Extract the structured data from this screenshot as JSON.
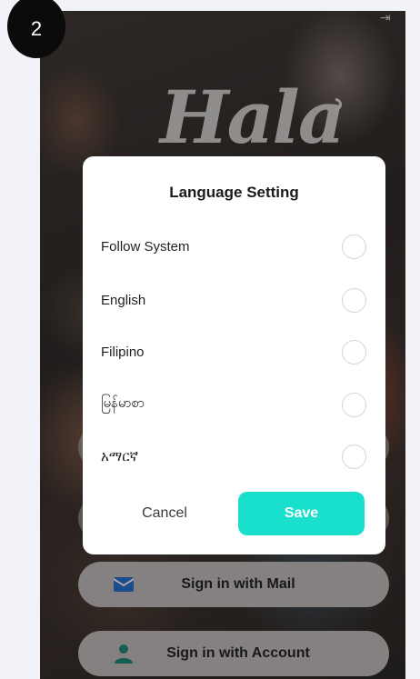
{
  "step": {
    "number": "2"
  },
  "app": {
    "logo_text": "Hala"
  },
  "dialog": {
    "title": "Language Setting",
    "options": [
      {
        "label": "Follow System",
        "selected": false
      },
      {
        "label": "English",
        "selected": false
      },
      {
        "label": "Filipino",
        "selected": false
      },
      {
        "label": "မြန်မာစာ",
        "selected": false
      },
      {
        "label": "አማርኛ",
        "selected": false
      }
    ],
    "cancel_label": "Cancel",
    "save_label": "Save"
  },
  "signin": {
    "mail_label": "Sign in with Mail",
    "account_label": "Sign in with Account"
  },
  "colors": {
    "save_button": "#19e0cc",
    "mail_icon": "#1e6fd9",
    "account_icon": "#178a7a"
  }
}
